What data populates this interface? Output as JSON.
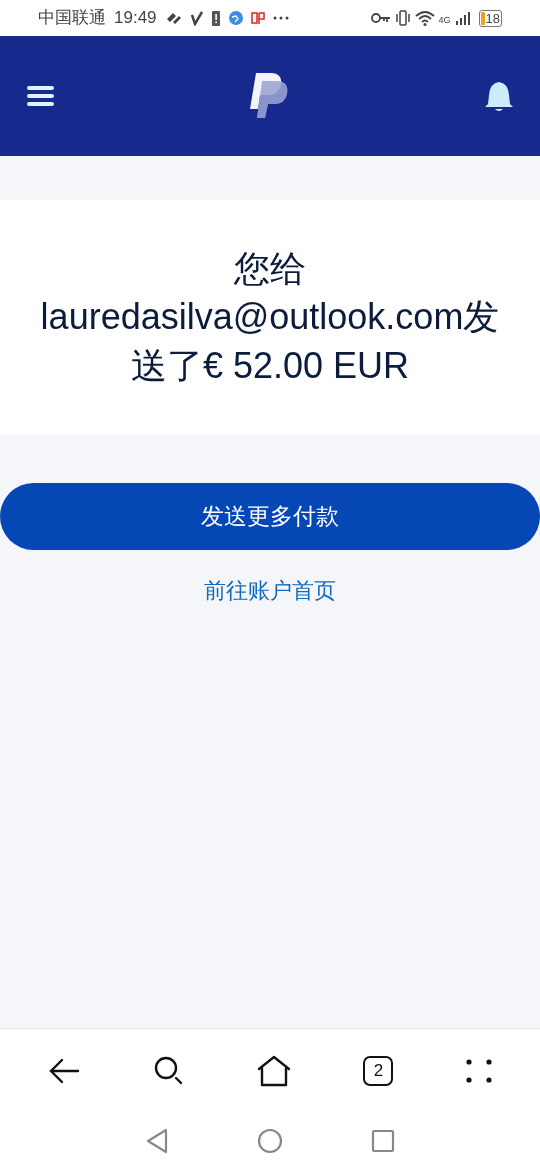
{
  "status_bar": {
    "carrier": "中国联通",
    "time": "19:49",
    "network": "4G",
    "battery": "18"
  },
  "message": "您给lauredasilva@outlook.com发送了€ 52.00 EUR",
  "actions": [
    {
      "kind": "primary",
      "label": "发送更多付款"
    },
    {
      "kind": "link",
      "label": "前往账户首页"
    }
  ],
  "browser_bar": {
    "tab_count": "2"
  }
}
